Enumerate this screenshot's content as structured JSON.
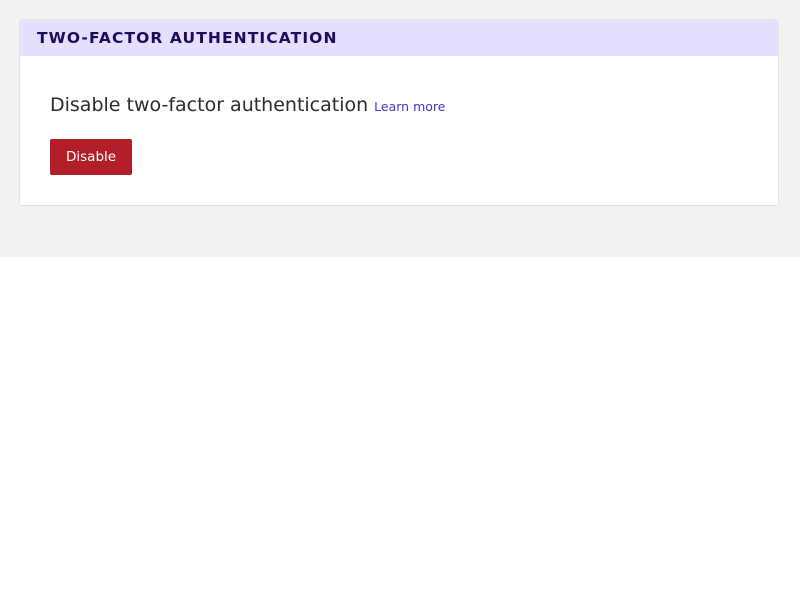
{
  "card": {
    "title": "TWO-FACTOR AUTHENTICATION",
    "heading": "Disable two-factor authentication",
    "learn_more_label": "Learn more",
    "disable_button_label": "Disable"
  },
  "colors": {
    "header_background": "#e4dffc",
    "header_text": "#1d0a5c",
    "link": "#4b32c3",
    "danger_button": "#b31f29",
    "page_background": "#f2f2f2"
  }
}
